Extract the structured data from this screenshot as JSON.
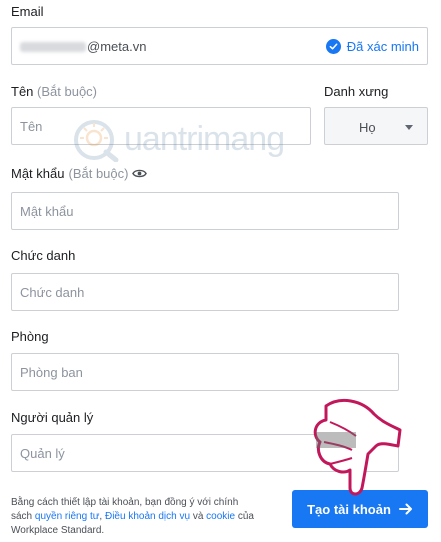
{
  "email": {
    "label": "Email",
    "value_visible": "@meta.vn",
    "verified_text": "Đã xác minh"
  },
  "first_name": {
    "label": "Tên",
    "optional_text": "(Bắt buộc)",
    "placeholder": "Tên"
  },
  "surname": {
    "label": "Danh xưng",
    "selected": "Họ"
  },
  "password": {
    "label": "Mật khẩu",
    "optional_text": "(Bắt buộc)",
    "placeholder": "Mật khẩu"
  },
  "title": {
    "label": "Chức danh",
    "placeholder": "Chức danh"
  },
  "department": {
    "label": "Phòng",
    "placeholder": "Phòng ban"
  },
  "manager": {
    "label": "Người quản lý",
    "placeholder": "Quản lý"
  },
  "legal": {
    "prefix": "Bằng cách thiết lập tài khoản, bạn đồng ý với chính sách ",
    "privacy_link": "quyền riêng tư",
    "sep1": ", ",
    "terms_link": "Điều khoản dịch vụ",
    "sep2": " và ",
    "cookie_link": "cookie",
    "suffix": " của Workplace Standard."
  },
  "submit": {
    "label": "Tạo tài khoản"
  },
  "watermark": {
    "text": "uantrimang"
  },
  "colors": {
    "accent": "#1877f2",
    "border": "#ccd0d5",
    "placeholder": "#8d949e"
  }
}
